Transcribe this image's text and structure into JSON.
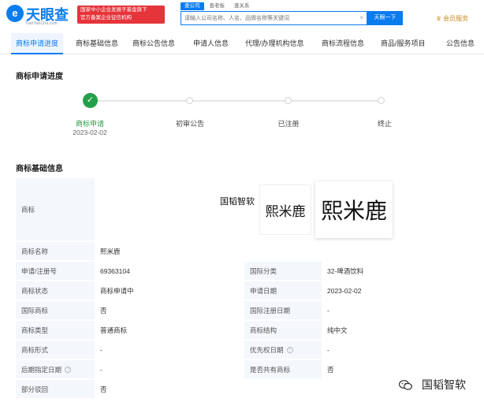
{
  "header": {
    "logo_mark": "e",
    "logo_text": "天眼查",
    "logo_sub": "TianYanCha.com",
    "gov_badge_line1": "国家中小企业发展子基金旗下",
    "gov_badge_line2": "官方备案企业征信机构",
    "search_tabs": [
      "查公司",
      "查老板",
      "查关系"
    ],
    "search_placeholder": "请输入公司名称、人名、品牌名称等关键词",
    "search_button": "天眼一下",
    "vip_label": "会员服务"
  },
  "tabs": [
    "商标申请进度",
    "商标基础信息",
    "商标公告信息",
    "申请人信息",
    "代理/办理机构信息",
    "商标流程信息",
    "商品/服务项目",
    "公告信息"
  ],
  "progress": {
    "title": "商标申请进度",
    "steps": [
      {
        "label": "商标申请",
        "date": "2023-02-02",
        "done": true
      },
      {
        "label": "初审公告",
        "done": false
      },
      {
        "label": "已注册",
        "done": false
      },
      {
        "label": "终止",
        "done": false
      }
    ]
  },
  "basic_info": {
    "title": "商标基础信息",
    "trademark_label": "商标",
    "trademark_image_text": "熙米鹿",
    "watermark_inline": "国韬智软",
    "rows": [
      {
        "l1": "商标名称",
        "v1": "熙米鹿"
      },
      {
        "l1": "申请/注册号",
        "v1": "69363104",
        "l2": "国际分类",
        "v2": "32-啤酒饮料"
      },
      {
        "l1": "商标状态",
        "v1": "商标申请中",
        "l2": "申请日期",
        "v2": "2023-02-02"
      },
      {
        "l1": "国际商标",
        "v1": "否",
        "l2": "国际注册日期",
        "v2": "-"
      },
      {
        "l1": "商标类型",
        "v1": "普通商标",
        "l2": "商标结构",
        "v2": "纯中文"
      },
      {
        "l1": "商标形式",
        "v1": "-",
        "l2": "优先权日期",
        "v2": "-"
      },
      {
        "l1": "后期指定日期",
        "v1": "-",
        "l2": "是否共有商标",
        "v2": "否"
      },
      {
        "l1": "部分驳回",
        "v1": "否"
      }
    ]
  },
  "watermark_bottom": "国韬智软",
  "colors": {
    "brand": "#0a7cf0",
    "badge_red": "#e5343a",
    "done_green": "#24a148",
    "label_bg": "#f4f7fb"
  }
}
